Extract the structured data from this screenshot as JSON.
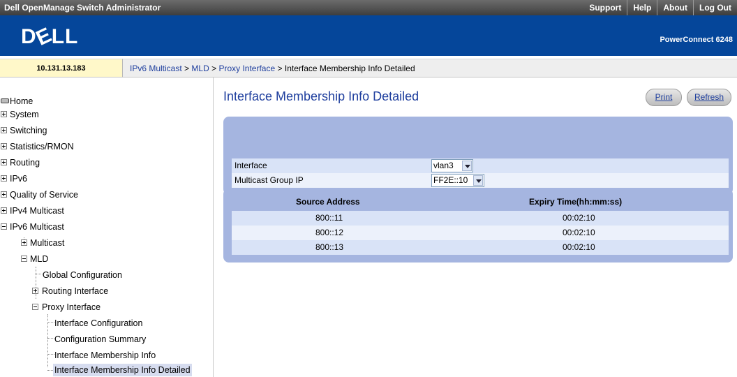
{
  "app": {
    "title": "Dell OpenManage Switch Administrator",
    "links": [
      "Support",
      "Help",
      "About",
      "Log Out"
    ],
    "logo": "DELL",
    "model": "PowerConnect 6248"
  },
  "ip_address": "10.131.13.183",
  "breadcrumb": {
    "items": [
      "IPv6 Multicast",
      "MLD",
      "Proxy Interface"
    ],
    "separator": ">",
    "current": "Interface Membership Info Detailed"
  },
  "nav": {
    "home": "Home",
    "items": [
      {
        "label": "System",
        "expander": "plus"
      },
      {
        "label": "Switching",
        "expander": "plus"
      },
      {
        "label": "Statistics/RMON",
        "expander": "plus"
      },
      {
        "label": "Routing",
        "expander": "plus"
      },
      {
        "label": "IPv6",
        "expander": "plus"
      },
      {
        "label": "Quality of Service",
        "expander": "plus"
      },
      {
        "label": "IPv4 Multicast",
        "expander": "plus"
      },
      {
        "label": "IPv6 Multicast",
        "expander": "minus"
      },
      {
        "label": "Multicast",
        "expander": "plus"
      },
      {
        "label": "MLD",
        "expander": "minus"
      },
      {
        "label": "Global Configuration",
        "expander": "none"
      },
      {
        "label": "Routing Interface",
        "expander": "plus"
      },
      {
        "label": "Proxy Interface",
        "expander": "minus"
      },
      {
        "label": "Interface Configuration",
        "expander": "none"
      },
      {
        "label": "Configuration Summary",
        "expander": "none"
      },
      {
        "label": "Interface Membership Info",
        "expander": "none"
      },
      {
        "label": "Interface Membership Info Detailed",
        "expander": "none",
        "selected": true
      }
    ]
  },
  "page": {
    "title": "Interface Membership Info Detailed",
    "print_label": "Print",
    "refresh_label": "Refresh"
  },
  "form": {
    "interface_label": "Interface",
    "interface_value": "vlan3",
    "group_label": "Multicast Group IP",
    "group_value": "FF2E::10"
  },
  "table": {
    "columns": [
      "Source Address",
      "Expiry Time(hh:mm:ss)"
    ],
    "rows": [
      [
        "800::11",
        "00:02:10"
      ],
      [
        "800::12",
        "00:02:10"
      ],
      [
        "800::13",
        "00:02:10"
      ]
    ]
  },
  "colors": {
    "brand": "#05469a",
    "panel": "#a5b5e0",
    "row_odd": "#d9e3f7",
    "row_even": "#ecf1fb",
    "title_text": "#1f3f9e",
    "ip_bar": "#fff8c9"
  },
  "icons": [
    "home-icon",
    "expand-plus-icon",
    "collapse-minus-icon",
    "dropdown-arrow-icon"
  ]
}
